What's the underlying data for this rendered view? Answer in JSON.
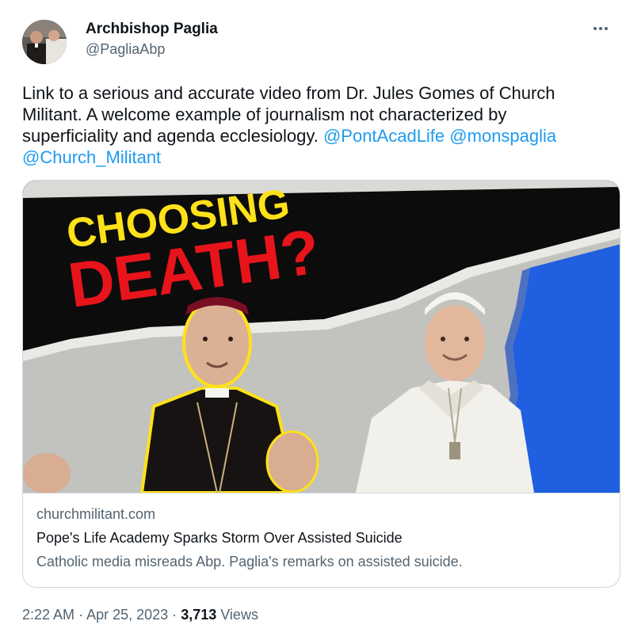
{
  "author": {
    "display_name": "Archbishop Paglia",
    "handle": "@PagliaAbp",
    "avatar_icon": "portrait-photo"
  },
  "more_icon": "ellipsis-icon",
  "tweet": {
    "text_line1": "Link to a serious and accurate video from Dr. Jules Gomes of Church",
    "text_line2": "Militant.  A welcome example of journalism not characterized by",
    "text_line3": "superficiality and agenda ecclesiology.",
    "mentions": [
      "@PontAcadLife",
      "@monspaglia",
      "@Church_Militant"
    ]
  },
  "card": {
    "image_headline_line1": "CHOOSING",
    "image_headline_line2": "DEATH?",
    "domain": "churchmilitant.com",
    "title": "Pope's Life Academy Sparks Storm Over Assisted Suicide",
    "description": "Catholic media misreads Abp. Paglia's remarks on assisted suicide."
  },
  "meta": {
    "time": "2:22 AM",
    "separator": "·",
    "date": "Apr 25, 2023",
    "views_count": "3,713",
    "views_label": "Views"
  },
  "colors": {
    "link": "#1d9bf0",
    "secondary_text": "#536471",
    "primary_text": "#0f1419",
    "border": "#cfd9de",
    "headline_yellow": "#ffe11a",
    "headline_red": "#e8141b",
    "accent_blue": "#1f5fe0"
  }
}
